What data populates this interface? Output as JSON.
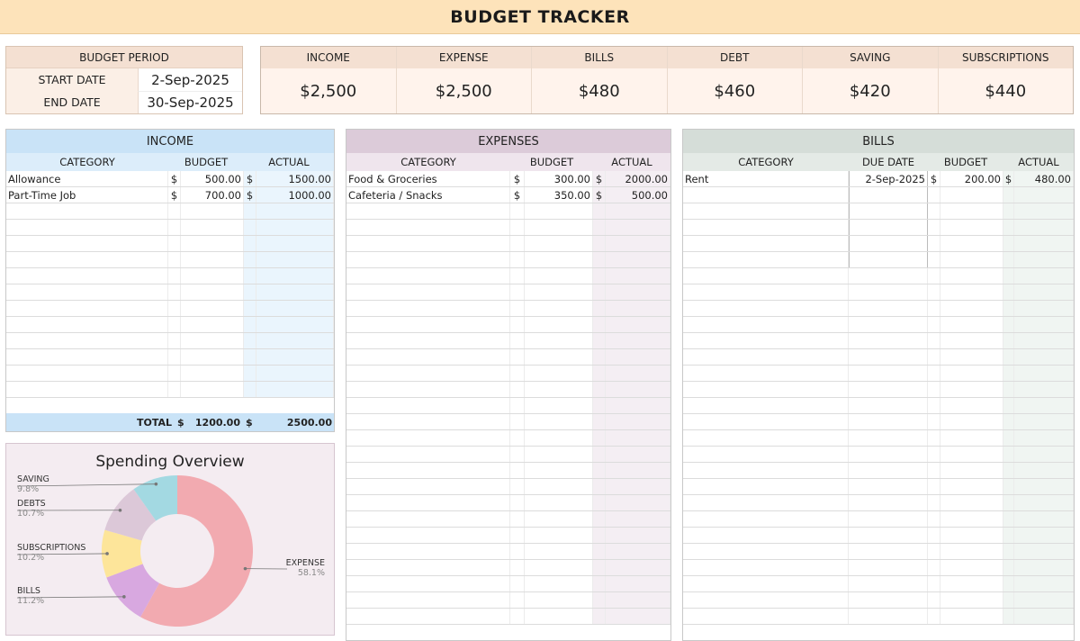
{
  "title": "BUDGET TRACKER",
  "period": {
    "header": "BUDGET PERIOD",
    "start_label": "START DATE",
    "start_value": "2-Sep-2025",
    "end_label": "END DATE",
    "end_value": "30-Sep-2025"
  },
  "summary": [
    {
      "label": "INCOME",
      "value": "$2,500"
    },
    {
      "label": "EXPENSE",
      "value": "$2,500"
    },
    {
      "label": "BILLS",
      "value": "$480"
    },
    {
      "label": "DEBT",
      "value": "$460"
    },
    {
      "label": "SAVING",
      "value": "$420"
    },
    {
      "label": "SUBSCRIPTIONS",
      "value": "$440"
    }
  ],
  "income": {
    "header": "INCOME",
    "columns": [
      "CATEGORY",
      "BUDGET",
      "ACTUAL"
    ],
    "rows": [
      {
        "category": "Allowance",
        "budget_sym": "$",
        "budget": "500.00",
        "actual_sym": "$",
        "actual": "1500.00"
      },
      {
        "category": "Part-Time Job",
        "budget_sym": "$",
        "budget": "700.00",
        "actual_sym": "$",
        "actual": "1000.00"
      }
    ],
    "total_label": "TOTAL",
    "total_budget_sym": "$",
    "total_budget": "1200.00",
    "total_actual_sym": "$",
    "total_actual": "2500.00"
  },
  "expenses": {
    "header": "EXPENSES",
    "columns": [
      "CATEGORY",
      "BUDGET",
      "ACTUAL"
    ],
    "rows": [
      {
        "category": "Food & Groceries",
        "budget_sym": "$",
        "budget": "300.00",
        "actual_sym": "$",
        "actual": "2000.00"
      },
      {
        "category": "Cafeteria / Snacks",
        "budget_sym": "$",
        "budget": "350.00",
        "actual_sym": "$",
        "actual": "500.00"
      }
    ]
  },
  "bills": {
    "header": "BILLS",
    "columns": [
      "CATEGORY",
      "DUE DATE",
      "BUDGET",
      "ACTUAL"
    ],
    "rows": [
      {
        "category": "Rent",
        "due": "2-Sep-2025",
        "budget_sym": "$",
        "budget": "200.00",
        "actual_sym": "$",
        "actual": "480.00"
      }
    ]
  },
  "chart_data": {
    "type": "pie",
    "title": "Spending Overview",
    "categories": [
      "EXPENSE",
      "BILLS",
      "SUBSCRIPTIONS",
      "DEBTS",
      "SAVING"
    ],
    "values": [
      58.1,
      11.2,
      10.2,
      10.7,
      9.8
    ],
    "labels": [
      "58.1%",
      "11.2%",
      "10.2%",
      "10.7%",
      "9.8%"
    ],
    "colors": [
      "#f2aab0",
      "#d8a8e0",
      "#fde59a",
      "#dcc8d8",
      "#a3d9e2"
    ],
    "donut": true
  }
}
